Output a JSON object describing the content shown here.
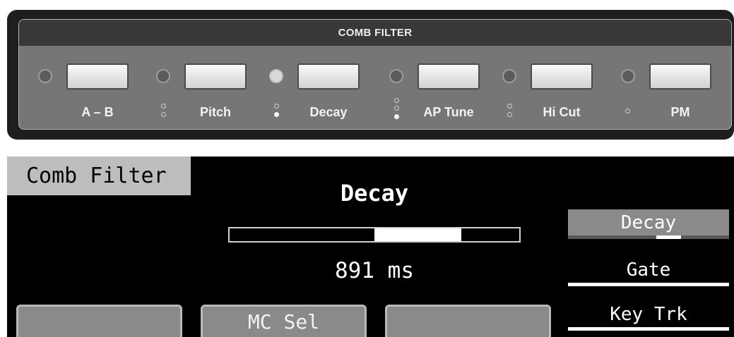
{
  "panel": {
    "title": "COMB FILTER",
    "buttons": [
      {
        "label": "A – B",
        "led_lit": false,
        "indicator_dots": [],
        "indicator_active": null
      },
      {
        "label": "Pitch",
        "led_lit": false,
        "indicator_dots": [
          false,
          false
        ],
        "indicator_active": "none"
      },
      {
        "label": "Decay",
        "led_lit": true,
        "indicator_dots": [
          false,
          true
        ],
        "indicator_active": "lower"
      },
      {
        "label": "AP Tune",
        "led_lit": false,
        "indicator_dots": [
          false,
          false,
          true
        ],
        "indicator_active": "lowest"
      },
      {
        "label": "Hi Cut",
        "led_lit": false,
        "indicator_dots": [
          false,
          false
        ],
        "indicator_active": "none"
      },
      {
        "label": "PM",
        "led_lit": false,
        "indicator_dots": [
          false
        ],
        "indicator_active": "none"
      }
    ]
  },
  "screen": {
    "tab_title": "Comb Filter",
    "parameter": {
      "name": "Decay",
      "value_text": "891 ms",
      "bar_range_fraction": [
        0.5,
        0.8
      ]
    },
    "right_menu": [
      {
        "label": "Decay",
        "selected": true,
        "underline_level": [
          0.55,
          0.7
        ]
      },
      {
        "label": "Gate",
        "selected": false,
        "underline_level": null
      },
      {
        "label": "Key Trk",
        "selected": false,
        "underline_level": null
      }
    ],
    "soft_keys": [
      "",
      "MC Sel",
      ""
    ]
  },
  "colors": {
    "panel_bg": "#767676",
    "panel_header": "#383838",
    "lcd_bg": "#000000",
    "lcd_tab": "#bdbdbd",
    "lcd_selected": "#8a8a8a"
  }
}
